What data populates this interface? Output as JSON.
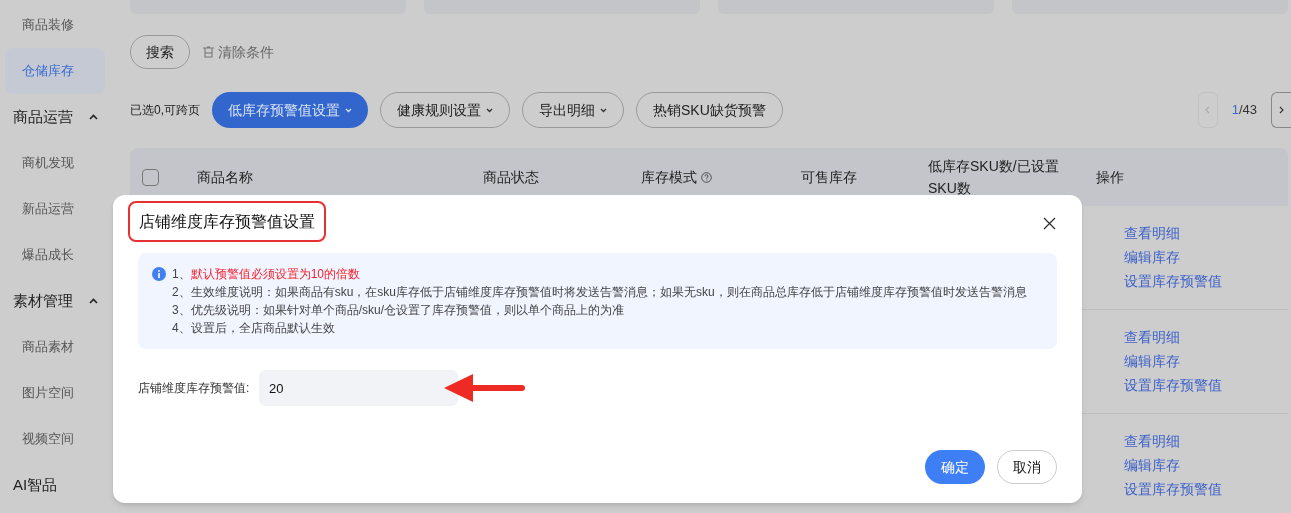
{
  "sidebar": {
    "items": [
      {
        "kind": "item",
        "label": "商品装修",
        "selected": false
      },
      {
        "kind": "item",
        "label": "仓储库存",
        "selected": true
      },
      {
        "kind": "group",
        "label": "商品运营",
        "expanded": true,
        "children": [
          {
            "label": "商机发现",
            "selected": false
          },
          {
            "label": "新品运营",
            "selected": false
          },
          {
            "label": "爆品成长",
            "selected": false
          }
        ]
      },
      {
        "kind": "group",
        "label": "素材管理",
        "expanded": true,
        "children": [
          {
            "label": "商品素材",
            "selected": false
          },
          {
            "label": "图片空间",
            "selected": false
          },
          {
            "label": "视频空间",
            "selected": false
          }
        ]
      },
      {
        "kind": "section",
        "label": "AI智品"
      }
    ]
  },
  "search": {
    "button": "搜索",
    "clear": "清除条件"
  },
  "toolbar": {
    "selection": "已选0,可跨页",
    "buttons": [
      {
        "label": "低库存预警值设置",
        "dropdown": true,
        "selected": true
      },
      {
        "label": "健康规则设置",
        "dropdown": true,
        "selected": false
      },
      {
        "label": "导出明细",
        "dropdown": true,
        "selected": false
      },
      {
        "label": "热销SKU缺货预警",
        "dropdown": false,
        "selected": false
      }
    ]
  },
  "pagination": {
    "current": "1",
    "total": "/43",
    "prev_disabled": true
  },
  "table": {
    "select_all": {
      "checked": false
    },
    "columns": [
      {
        "label": "商品名称",
        "help": false
      },
      {
        "label": "商品状态",
        "help": false
      },
      {
        "label": "库存模式",
        "help": true
      },
      {
        "label": "可售库存",
        "help": false
      },
      {
        "label": "低库存SKU数/已设置SKU数",
        "help": false
      },
      {
        "label": "操作",
        "help": false
      }
    ],
    "rows": [
      {
        "actions": [
          "查看明细",
          "编辑库存",
          "设置库存预警值"
        ]
      },
      {
        "actions": [
          "查看明细",
          "编辑库存",
          "设置库存预警值"
        ]
      },
      {
        "actions": [
          "查看明细",
          "编辑库存",
          "设置库存预警值"
        ]
      }
    ]
  },
  "dialog": {
    "title": "店铺维度库存预警值设置",
    "notes": [
      {
        "number": "1、",
        "text": "默认预警值必须设置为10的倍数",
        "emphasis": true
      },
      {
        "number": "2、",
        "text": "生效维度说明：如果商品有sku，在sku库存低于店铺维度库存预警值时将发送告警消息；如果无sku，则在商品总库存低于店铺维度库存预警值时发送告警消息",
        "emphasis": false
      },
      {
        "number": "3、",
        "text": "优先级说明：如果针对单个商品/sku/仓设置了库存预警值，则以单个商品上的为准",
        "emphasis": false
      },
      {
        "number": "4、",
        "text": "设置后，全店商品默认生效",
        "emphasis": false
      }
    ],
    "field": {
      "label": "店铺维度库存预警值:",
      "value": "20"
    },
    "buttons": [
      {
        "label": "确定",
        "kind": "primary"
      },
      {
        "label": "取消",
        "kind": "secondary"
      }
    ]
  }
}
